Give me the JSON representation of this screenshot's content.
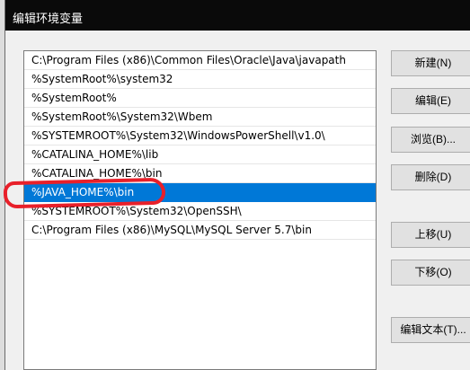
{
  "window": {
    "title": "编辑环境变量"
  },
  "entries": [
    "C:\\Program Files (x86)\\Common Files\\Oracle\\Java\\javapath",
    "%SystemRoot%\\system32",
    "%SystemRoot%",
    "%SystemRoot%\\System32\\Wbem",
    "%SYSTEMROOT%\\System32\\WindowsPowerShell\\v1.0\\",
    "%CATALINA_HOME%\\lib",
    "%CATALINA_HOME%\\bin",
    "%JAVA_HOME%\\bin",
    "%SYSTEMROOT%\\System32\\OpenSSH\\",
    "C:\\Program Files (x86)\\MySQL\\MySQL Server 5.7\\bin"
  ],
  "selected_index": 7,
  "buttons": {
    "new": "新建(N)",
    "edit": "编辑(E)",
    "browse": "浏览(B)...",
    "delete": "删除(D)",
    "move_up": "上移(U)",
    "move_down": "下移(O)",
    "edit_text": "编辑文本(T)..."
  },
  "annotation_color": "#e8202a",
  "selection_color": "#0078d7"
}
